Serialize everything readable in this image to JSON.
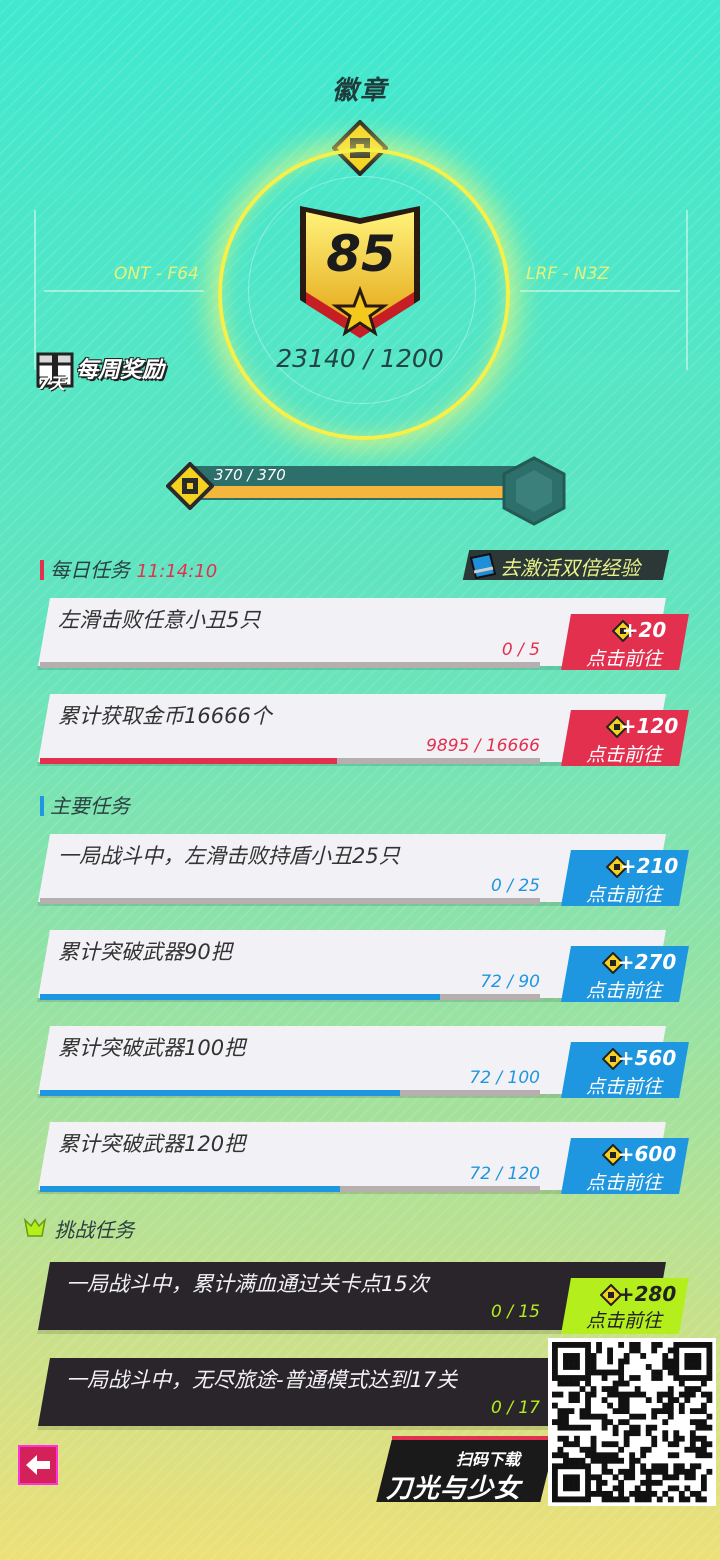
{
  "header": {
    "title": "徽章"
  },
  "badge": {
    "level": "85",
    "score": "23140 / 1200",
    "left_code": "ONT - F64",
    "right_code": "LRF - N3Z"
  },
  "weekly": {
    "label": "每周奖励",
    "days": "7天"
  },
  "xp": {
    "text": "370 / 370",
    "fill_fraction": 1.0
  },
  "daily": {
    "title": "每日任务",
    "timer": "11:14:10",
    "double_exp": "去激活双倍经验",
    "tasks": [
      {
        "text": "左滑击败任意小丑5只",
        "progress": "0 / 5",
        "fraction": 0,
        "reward": "+20",
        "go": "点击前往"
      },
      {
        "text": "累计获取金币16666个",
        "progress": "9895 / 16666",
        "fraction": 0.594,
        "reward": "+120",
        "go": "点击前往"
      }
    ]
  },
  "main": {
    "title": "主要任务",
    "tasks": [
      {
        "text": "一局战斗中，左滑击败持盾小丑25只",
        "progress": "0 / 25",
        "fraction": 0,
        "reward": "+210",
        "go": "点击前往"
      },
      {
        "text": "累计突破武器90把",
        "progress": "72 / 90",
        "fraction": 0.8,
        "reward": "+270",
        "go": "点击前往"
      },
      {
        "text": "累计突破武器100把",
        "progress": "72 / 100",
        "fraction": 0.72,
        "reward": "+560",
        "go": "点击前往"
      },
      {
        "text": "累计突破武器120把",
        "progress": "72 / 120",
        "fraction": 0.6,
        "reward": "+600",
        "go": "点击前往"
      }
    ]
  },
  "challenge": {
    "title": "挑战任务",
    "tasks": [
      {
        "text": "一局战斗中，累计满血通过关卡点15次",
        "progress": "0 / 15",
        "reward": "+280",
        "go": "点击前往"
      },
      {
        "text": "一局战斗中，无尽旅途-普通模式达到17关",
        "progress": "0 / 17"
      }
    ]
  },
  "promo": {
    "scan": "扫码下载",
    "game_name": "刀光与少女"
  },
  "colors": {
    "daily": "#e4304f",
    "main": "#1f96e0",
    "challenge": "#b4ee1d",
    "xp": "#f4b63d"
  },
  "icons": {
    "back": "back-arrow-icon",
    "coin": "badge-coin-icon"
  }
}
